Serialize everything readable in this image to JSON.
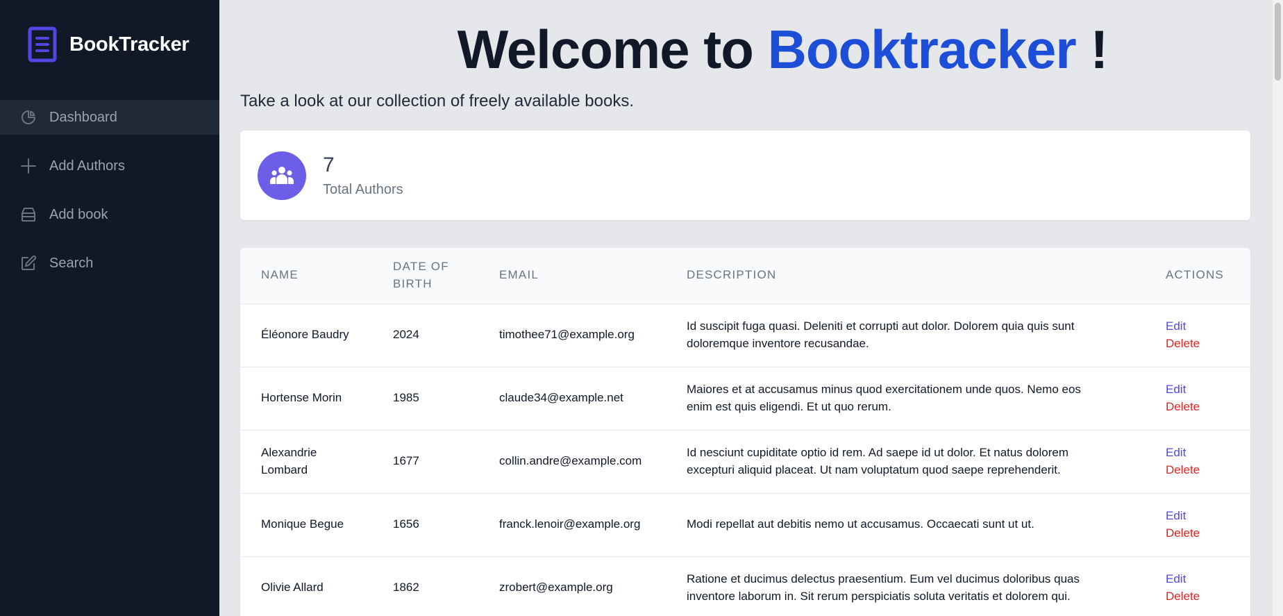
{
  "app": {
    "brand_name": "BookTracker",
    "accent_color": "#1d4ed8",
    "sidebar_bg": "#111827"
  },
  "sidebar": {
    "items": [
      {
        "label": "Dashboard",
        "icon": "pie-chart-icon",
        "active": true
      },
      {
        "label": "Add Authors",
        "icon": "plus-icon",
        "active": false
      },
      {
        "label": "Add book",
        "icon": "box-icon",
        "active": false
      },
      {
        "label": "Search",
        "icon": "edit-icon",
        "active": false
      }
    ]
  },
  "main": {
    "title_prefix": "Welcome to ",
    "title_accent": "Booktracker",
    "title_suffix": " !",
    "subtitle": "Take a look at our collection of freely available books.",
    "stat": {
      "value": "7",
      "label": "Total Authors",
      "icon": "users-icon"
    },
    "table": {
      "headers": [
        "Name",
        "Date of birth",
        "Email",
        "Description",
        "Actions"
      ],
      "rows": [
        {
          "name": "Éléonore Baudry",
          "dob": "2024",
          "email": "timothee71@example.org",
          "description": "Id suscipit fuga quasi. Deleniti et corrupti aut dolor. Dolorem quia quis sunt doloremque inventore recusandae.",
          "edit": "Edit",
          "delete": "Delete"
        },
        {
          "name": "Hortense Morin",
          "dob": "1985",
          "email": "claude34@example.net",
          "description": "Maiores et at accusamus minus quod exercitationem unde quos. Nemo eos enim est quis eligendi. Et ut quo rerum.",
          "edit": "Edit",
          "delete": "Delete"
        },
        {
          "name": "Alexandrie Lombard",
          "dob": "1677",
          "email": "collin.andre@example.com",
          "description": "Id nesciunt cupiditate optio id rem. Ad saepe id ut dolor. Et natus dolorem excepturi aliquid placeat. Ut nam voluptatum quod saepe reprehenderit.",
          "edit": "Edit",
          "delete": "Delete"
        },
        {
          "name": "Monique Begue",
          "dob": "1656",
          "email": "franck.lenoir@example.org",
          "description": "Modi repellat aut debitis nemo ut accusamus. Occaecati sunt ut ut.",
          "edit": "Edit",
          "delete": "Delete"
        },
        {
          "name": "Olivie Allard",
          "dob": "1862",
          "email": "zrobert@example.org",
          "description": "Ratione et ducimus delectus praesentium. Eum vel ducimus doloribus quas inventore laborum in. Sit rerum perspiciatis soluta veritatis et dolorem qui.",
          "edit": "Edit",
          "delete": "Delete"
        }
      ]
    }
  }
}
